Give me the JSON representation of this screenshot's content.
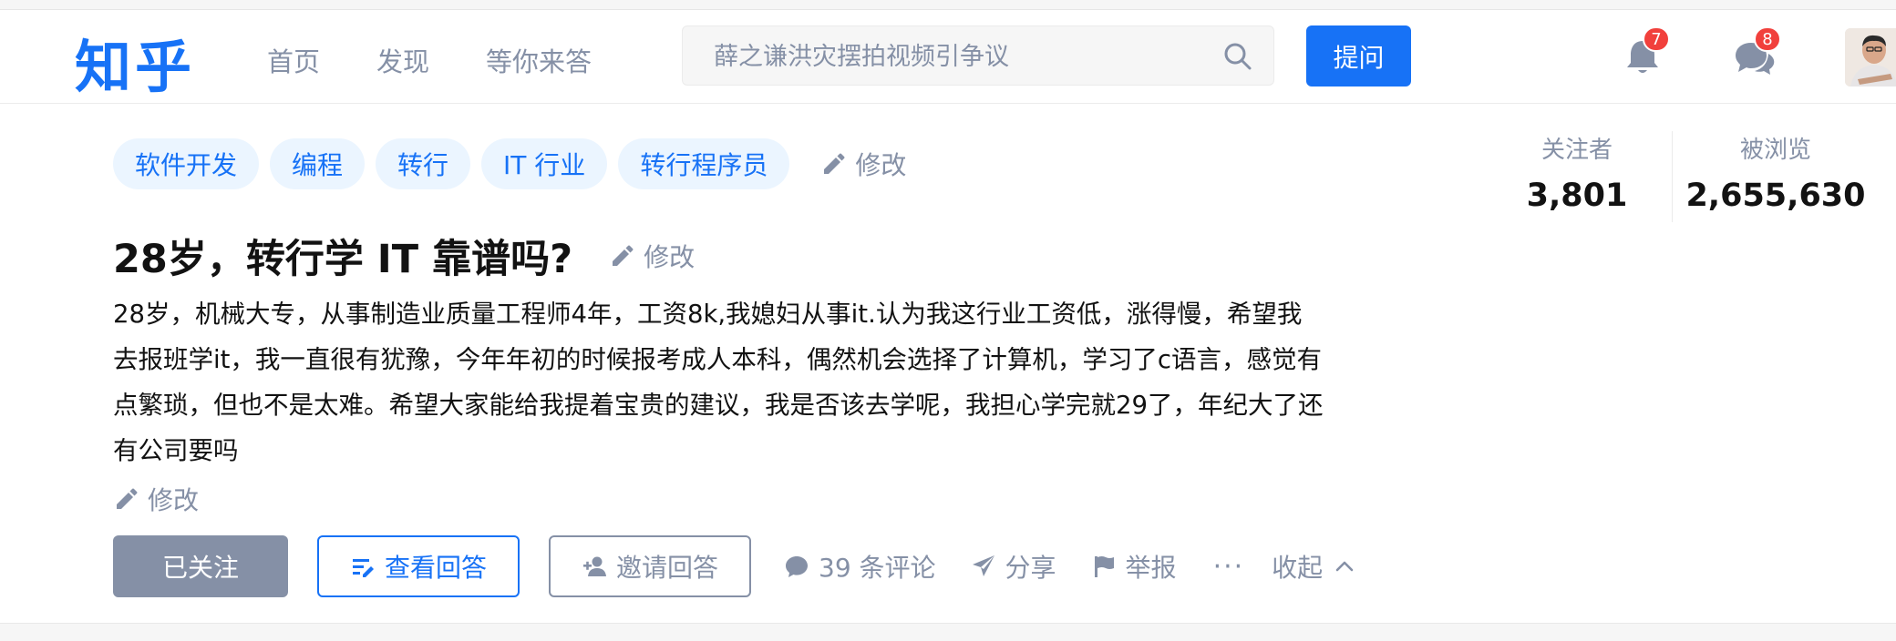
{
  "header": {
    "logo": "知乎",
    "nav": [
      "首页",
      "发现",
      "等你来答"
    ],
    "search_placeholder": "薛之谦洪灾摆拍视频引争议",
    "ask_label": "提问",
    "notifications_count": "7",
    "messages_count": "8",
    "accent_color": "#1772f6",
    "badge_color": "#f1403c"
  },
  "question": {
    "topics": [
      "软件开发",
      "编程",
      "转行",
      "IT 行业",
      "转行程序员"
    ],
    "edit_label": "修改",
    "title": "28岁，转行学 IT 靠谱吗?",
    "detail": "28岁，机械大专，从事制造业质量工程师4年，工资8k,我媳妇从事it.认为我这行业工资低，涨得慢，希望我去报班学it，我一直很有犹豫，今年年初的时候报考成人本科，偶然机会选择了计算机，学习了c语言，感觉有点繁琐，但也不是太难。希望大家能给我提着宝贵的建议，我是否该去学呢，我担心学完就29了，年纪大了还有公司要吗",
    "stats": {
      "followers_label": "关注者",
      "followers": "3,801",
      "views_label": "被浏览",
      "views": "2,655,630"
    },
    "actions": {
      "followed": "已关注",
      "view_answers": "查看回答",
      "invite": "邀请回答",
      "comments": "39 条评论",
      "share": "分享",
      "report": "举报",
      "more": "···",
      "collapse": "收起"
    }
  }
}
